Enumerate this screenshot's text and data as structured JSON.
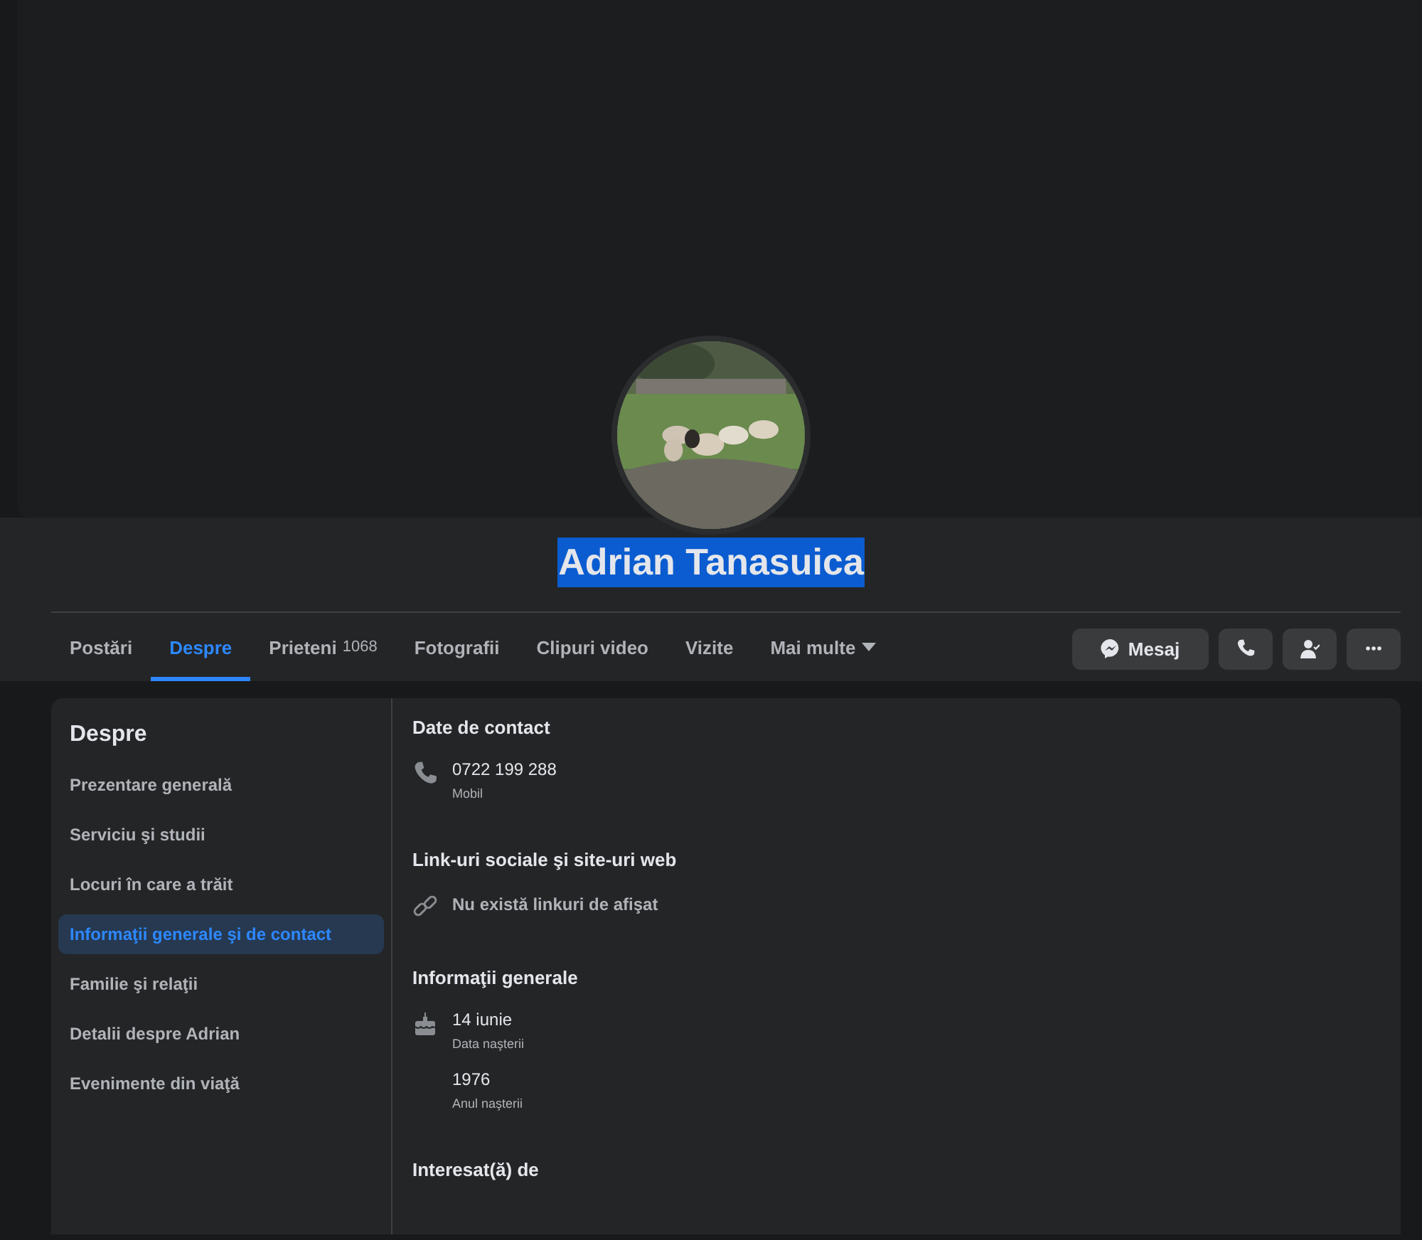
{
  "profile": {
    "name": "Adrian Tanasuica",
    "highlighted": true
  },
  "tabs": [
    {
      "label": "Postări",
      "selected": false
    },
    {
      "label": "Despre",
      "selected": true
    },
    {
      "label": "Prieteni",
      "count": "1068",
      "selected": false
    },
    {
      "label": "Fotografii",
      "selected": false
    },
    {
      "label": "Clipuri video",
      "selected": false
    },
    {
      "label": "Vizite",
      "selected": false
    },
    {
      "label": "Mai multe",
      "dropdown": true,
      "selected": false
    }
  ],
  "actions": [
    {
      "kind": "message",
      "label": "Mesaj"
    },
    {
      "kind": "call"
    },
    {
      "kind": "friend"
    },
    {
      "kind": "more"
    }
  ],
  "sidebar": {
    "title": "Despre",
    "items": [
      {
        "label": "Prezentare generală",
        "selected": false
      },
      {
        "label": "Serviciu şi studii",
        "selected": false
      },
      {
        "label": "Locuri în care a trăit",
        "selected": false
      },
      {
        "label": "Informaţii generale şi de contact",
        "selected": true
      },
      {
        "label": "Familie şi relaţii",
        "selected": false
      },
      {
        "label": "Detalii despre Adrian",
        "selected": false
      },
      {
        "label": "Evenimente din viaţă",
        "selected": false
      }
    ]
  },
  "sections": [
    {
      "title": "Date de contact",
      "entries": [
        {
          "kind": "phone",
          "value": "0722 199 288",
          "caption": "Mobil"
        }
      ]
    },
    {
      "title": "Link-uri sociale şi site-uri web",
      "entries": [
        {
          "kind": "link",
          "empty": true,
          "value": "Nu există linkuri de afişat"
        }
      ]
    },
    {
      "title": "Informaţii generale",
      "entries": [
        {
          "kind": "birthday",
          "value": "14 iunie",
          "caption": "Data naşterii"
        },
        {
          "kind": "year",
          "value": "1976",
          "caption": "Anul naşterii"
        }
      ]
    },
    {
      "title": "Interesat(ă) de"
    }
  ]
}
